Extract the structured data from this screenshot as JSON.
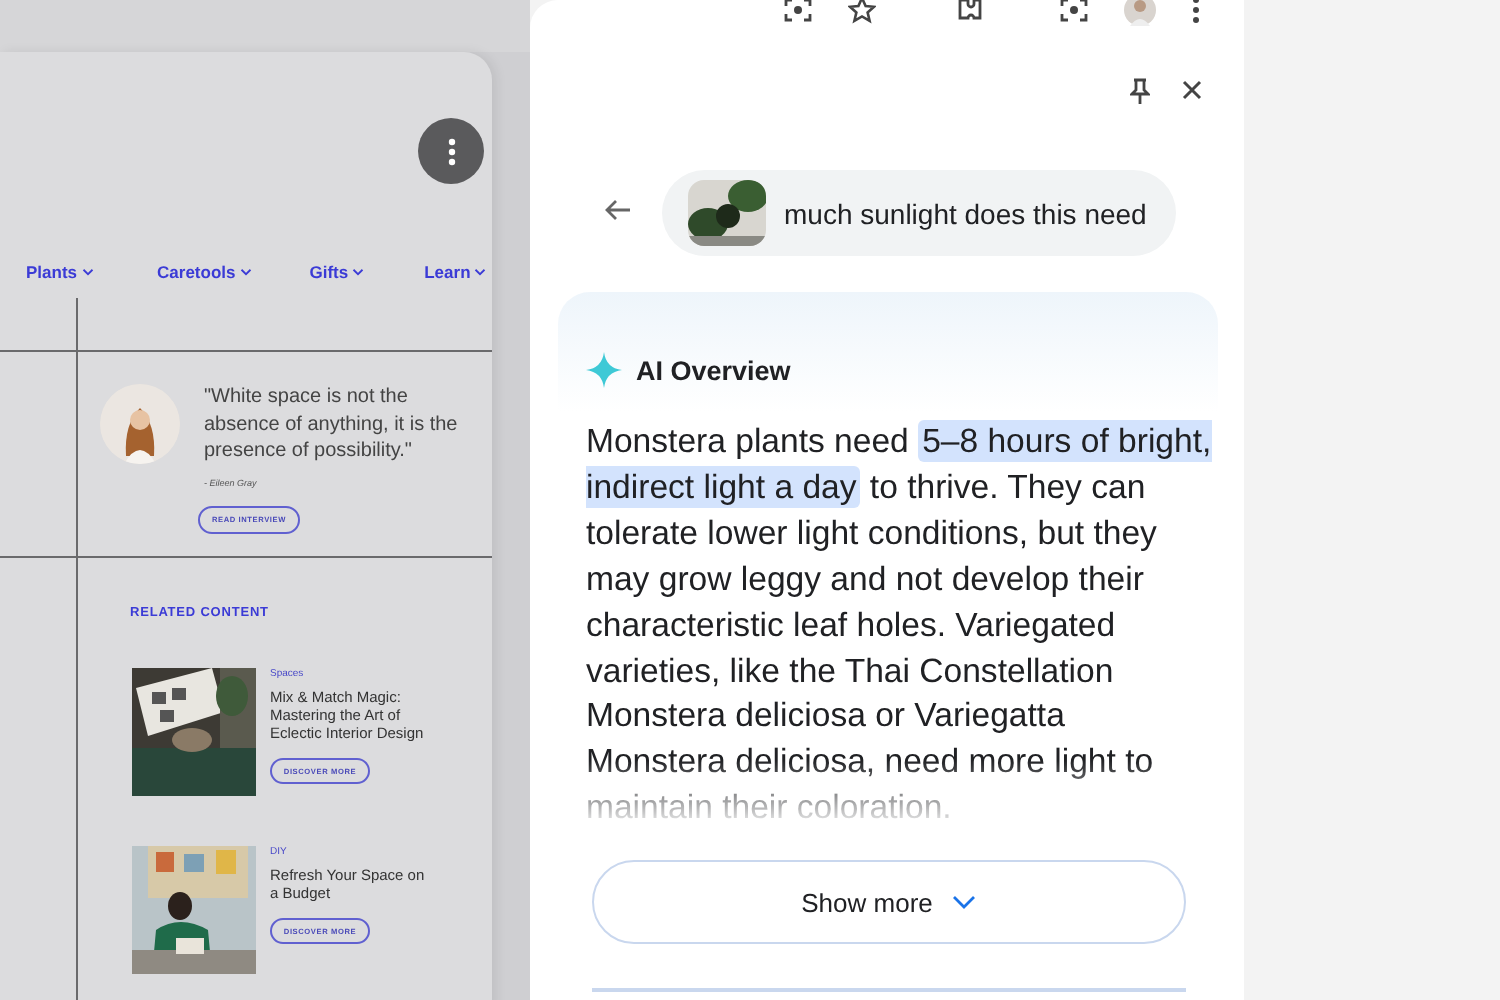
{
  "webpage": {
    "nav": [
      {
        "label": "Plants"
      },
      {
        "label": "Caretools"
      },
      {
        "label": "Gifts"
      },
      {
        "label": "Learn"
      }
    ],
    "quote": {
      "text": "\"White space is not the absence of anything, it is the presence of possibility.\"",
      "author": "- Eileen Gray",
      "button": "READ INTERVIEW"
    },
    "related": {
      "heading": "RELATED CONTENT",
      "items": [
        {
          "category": "Spaces",
          "title": "Mix & Match Magic: Mastering the Art of Eclectic Interior Design",
          "button": "DISCOVER MORE"
        },
        {
          "category": "DIY",
          "title": "Refresh Your Space on a Budget",
          "button": "DISCOVER MORE"
        }
      ]
    }
  },
  "side_panel": {
    "query": "much sunlight does this need",
    "overview": {
      "title": "AI Overview",
      "answer": [
        {
          "text": "Monstera plants need ",
          "highlighted": false
        },
        {
          "text": "5–8 hours of bright, indirect light a day",
          "highlighted": true
        },
        {
          "text": " to thrive. They can tolerate lower light conditions, but they may grow leggy and not develop their characteristic leaf holes. Variegated varieties, like the Thai Constellation Monstera deliciosa or Variegatta Monstera deliciosa, need more light to maintain their coloration.",
          "highlighted": false
        }
      ],
      "show_more": "Show more"
    }
  }
}
